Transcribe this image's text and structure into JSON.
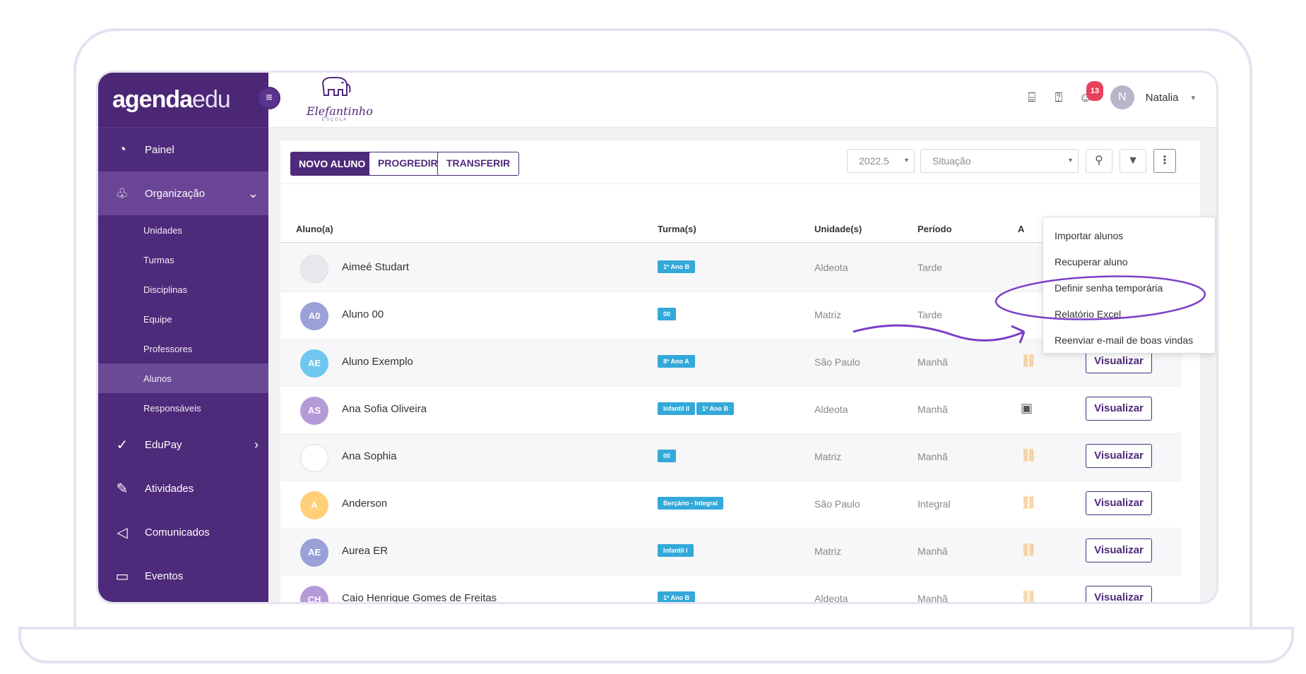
{
  "brand": {
    "bold": "agenda",
    "light": "edu"
  },
  "school": {
    "name": "Elefantinho",
    "sub": "ESCOLA"
  },
  "sidebar": {
    "toggle_icon": "hamburger-icon",
    "items": [
      {
        "label": "Painel",
        "icon": "dashboard-icon"
      },
      {
        "label": "Organização",
        "icon": "org-chart-icon"
      },
      {
        "label": "EduPay",
        "icon": "checkmark-icon"
      },
      {
        "label": "Atividades",
        "icon": "pen-icon"
      },
      {
        "label": "Comunicados",
        "icon": "megaphone-icon"
      },
      {
        "label": "Eventos",
        "icon": "calendar-icon"
      }
    ],
    "sub_items": [
      "Unidades",
      "Turmas",
      "Disciplinas",
      "Equipe",
      "Professores",
      "Alunos",
      "Responsáveis"
    ]
  },
  "topbar": {
    "badge": "13",
    "avatar_initial": "N",
    "user_name": "Natalia"
  },
  "toolbar": {
    "new_student": "NOVO ALUNO",
    "progress": "PROGREDIR",
    "transfer": "TRANSFERIR",
    "year": "2022.5",
    "status_placeholder": "Situação"
  },
  "table": {
    "headers": {
      "student": "Aluno(a)",
      "class": "Turma(s)",
      "unit": "Unidade(s)",
      "period": "Período",
      "access": "A"
    },
    "view_label": "Visualizar",
    "rows": [
      {
        "initials": "",
        "name": "Aimeé Studart",
        "tags": [
          "1º Ano B"
        ],
        "unit": "Aldeota",
        "period": "Tarde",
        "color": "#e8e8ec"
      },
      {
        "initials": "A0",
        "name": "Aluno 00",
        "tags": [
          "00"
        ],
        "unit": "Matriz",
        "period": "Tarde",
        "color": "#9aa0d8"
      },
      {
        "initials": "AE",
        "name": "Aluno Exemplo",
        "tags": [
          "8º Ano A"
        ],
        "unit": "São Paulo",
        "period": "Manhã",
        "color": "#6fc6ee"
      },
      {
        "initials": "AS",
        "name": "Ana Sofia Oliveira",
        "tags": [
          "Infantil II",
          "1º Ano B"
        ],
        "unit": "Aldeota",
        "period": "Manhã",
        "color": "#b59ad8"
      },
      {
        "initials": "",
        "name": "Ana Sophia",
        "tags": [
          "00"
        ],
        "unit": "Matriz",
        "period": "Manhã",
        "color": "#ffffff"
      },
      {
        "initials": "A",
        "name": "Anderson",
        "tags": [
          "Berçário - Integral"
        ],
        "unit": "São Paulo",
        "period": "Integral",
        "color": "#ffcf7a"
      },
      {
        "initials": "AE",
        "name": "Aurea ER",
        "tags": [
          "Infantil I"
        ],
        "unit": "Matriz",
        "period": "Manhã",
        "color": "#9aa0d8"
      },
      {
        "initials": "CH",
        "name": "Caio Henrique Gomes de Freitas",
        "tags": [
          "1º Ano B"
        ],
        "unit": "Aldeota",
        "period": "Manhã",
        "color": "#b59ad8"
      }
    ]
  },
  "dropdown": [
    "Importar alunos",
    "Recuperar aluno",
    "Definir senha temporária",
    "Relatório Excel",
    "Reenviar e-mail de boas vindas"
  ],
  "accent": "#4e2a7a",
  "annotation_color": "#7b3fc9"
}
